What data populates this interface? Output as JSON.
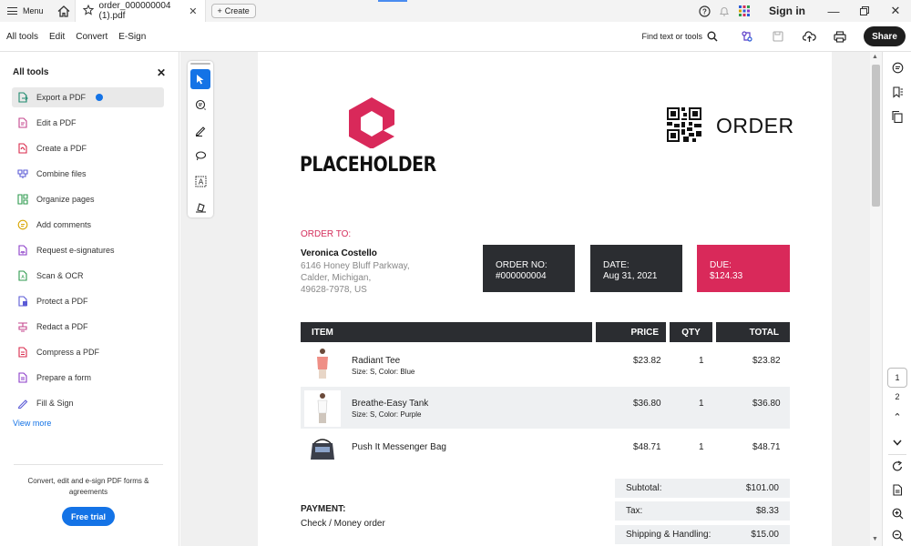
{
  "titlebar": {
    "menu_label": "Menu",
    "tab_title": "order_000000004 (1).pdf",
    "create_label": "Create",
    "signin_label": "Sign in"
  },
  "menubar": {
    "items": [
      "All tools",
      "Edit",
      "Convert",
      "E-Sign"
    ],
    "find_label": "Find text or tools",
    "share_label": "Share"
  },
  "sidebar": {
    "title": "All tools",
    "tools": [
      {
        "label": "Export a PDF",
        "icon": "export-pdf-icon",
        "color": "#1e8a6e",
        "active": true
      },
      {
        "label": "Edit a PDF",
        "icon": "edit-pdf-icon",
        "color": "#c4458c"
      },
      {
        "label": "Create a PDF",
        "icon": "create-pdf-icon",
        "color": "#d9294b"
      },
      {
        "label": "Combine files",
        "icon": "combine-files-icon",
        "color": "#5b5bd6"
      },
      {
        "label": "Organize pages",
        "icon": "organize-pages-icon",
        "color": "#2f9a4f"
      },
      {
        "label": "Add comments",
        "icon": "add-comments-icon",
        "color": "#d8a500"
      },
      {
        "label": "Request e-signatures",
        "icon": "request-esignatures-icon",
        "color": "#8b3cc8"
      },
      {
        "label": "Scan & OCR",
        "icon": "scan-ocr-icon",
        "color": "#2f9a4f"
      },
      {
        "label": "Protect a PDF",
        "icon": "protect-pdf-icon",
        "color": "#5b5bd6"
      },
      {
        "label": "Redact a PDF",
        "icon": "redact-pdf-icon",
        "color": "#c4458c"
      },
      {
        "label": "Compress a PDF",
        "icon": "compress-pdf-icon",
        "color": "#d9294b"
      },
      {
        "label": "Prepare a form",
        "icon": "prepare-form-icon",
        "color": "#8b3cc8"
      },
      {
        "label": "Fill & Sign",
        "icon": "fill-sign-icon",
        "color": "#5b5bd6"
      }
    ],
    "view_more": "View more",
    "promo_text": "Convert, edit and e-sign PDF forms & agreements",
    "trial_label": "Free trial"
  },
  "document": {
    "logo_text": "PLACEHOLDER",
    "heading": "ORDER",
    "order_to_label": "ORDER TO:",
    "customer_name": "Veronica Costello",
    "customer_address": [
      "6146 Honey Bluff Parkway,",
      "Calder, Michigan,",
      "49628-7978, US"
    ],
    "boxes": [
      {
        "label": "ORDER NO:",
        "value": "#000000004"
      },
      {
        "label": "DATE:",
        "value": "Aug 31, 2021"
      },
      {
        "label": "DUE:",
        "value": "$124.33"
      }
    ],
    "columns": [
      "ITEM",
      "PRICE",
      "QTY",
      "TOTAL"
    ],
    "items": [
      {
        "name": "Radiant Tee",
        "options": "Size: S, Color: Blue",
        "price": "$23.82",
        "qty": "1",
        "total": "$23.82"
      },
      {
        "name": "Breathe-Easy Tank",
        "options": "Size: S, Color: Purple",
        "price": "$36.80",
        "qty": "1",
        "total": "$36.80"
      },
      {
        "name": "Push It Messenger Bag",
        "options": "",
        "price": "$48.71",
        "qty": "1",
        "total": "$48.71"
      }
    ],
    "totals": [
      {
        "label": "Subtotal:",
        "value": "$101.00"
      },
      {
        "label": "Tax:",
        "value": "$8.33"
      },
      {
        "label": "Shipping & Handling:",
        "value": "$15.00"
      }
    ],
    "payment_label": "PAYMENT:",
    "payment_method": "Check / Money order",
    "accent_color": "#d9295a",
    "dark_color": "#2b2d31"
  },
  "rightrail": {
    "current_page": "1",
    "next_page": "2"
  }
}
